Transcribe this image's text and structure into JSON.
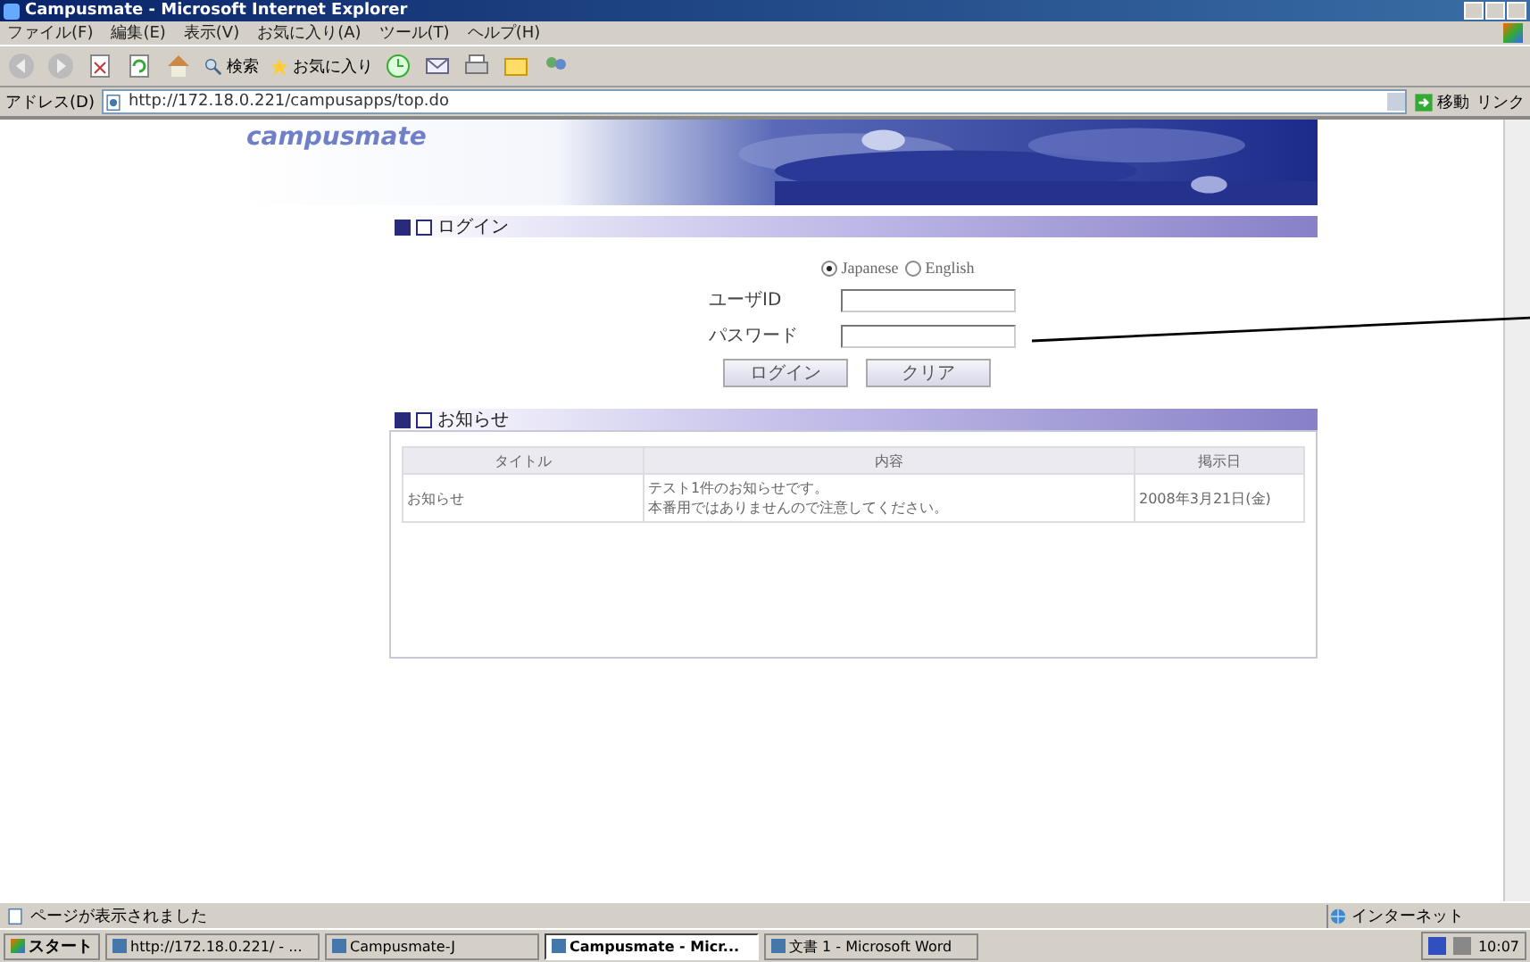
{
  "window": {
    "title": "Campusmate - Microsoft Internet Explorer"
  },
  "menu": [
    "ファイル(F)",
    "編集(E)",
    "表示(V)",
    "お気に入り(A)",
    "ツール(T)",
    "ヘルプ(H)"
  ],
  "toolbar": {
    "search": "検索",
    "favorites": "お気に入り"
  },
  "address": {
    "label": "アドレス(D)",
    "value": "http://172.18.0.221/campusapps/top.do",
    "go": "移動",
    "links": "リンク"
  },
  "header": {
    "logo": "campusmate"
  },
  "login": {
    "title": "ログイン",
    "languages": [
      {
        "label": "Japanese",
        "selected": true
      },
      {
        "label": "English",
        "selected": false
      }
    ],
    "user_label": "ユーザID",
    "password_label": "パスワード",
    "buttons": [
      "ログイン",
      "クリア"
    ]
  },
  "news": {
    "title": "お知らせ",
    "columns": [
      "タイトル",
      "内容",
      "掲示日"
    ],
    "rows": [
      {
        "title": "お知らせ",
        "content": [
          "テスト1件のお知らせです。",
          "本番用ではありませんので注意してください。"
        ],
        "date": "2008年3月21日(金)"
      }
    ]
  },
  "status_bar": {
    "text": "ページが表示されました",
    "zone": "インターネット"
  },
  "taskbar": {
    "start": "スタート",
    "items": [
      {
        "label": "http://172.18.0.221/ - ...",
        "selected": false
      },
      {
        "label": "Campusmate-J",
        "selected": false
      },
      {
        "label": "Campusmate - Micr...",
        "selected": true
      },
      {
        "label": "文書 1 - Microsoft Word",
        "selected": false
      }
    ],
    "clock": "10:07"
  }
}
